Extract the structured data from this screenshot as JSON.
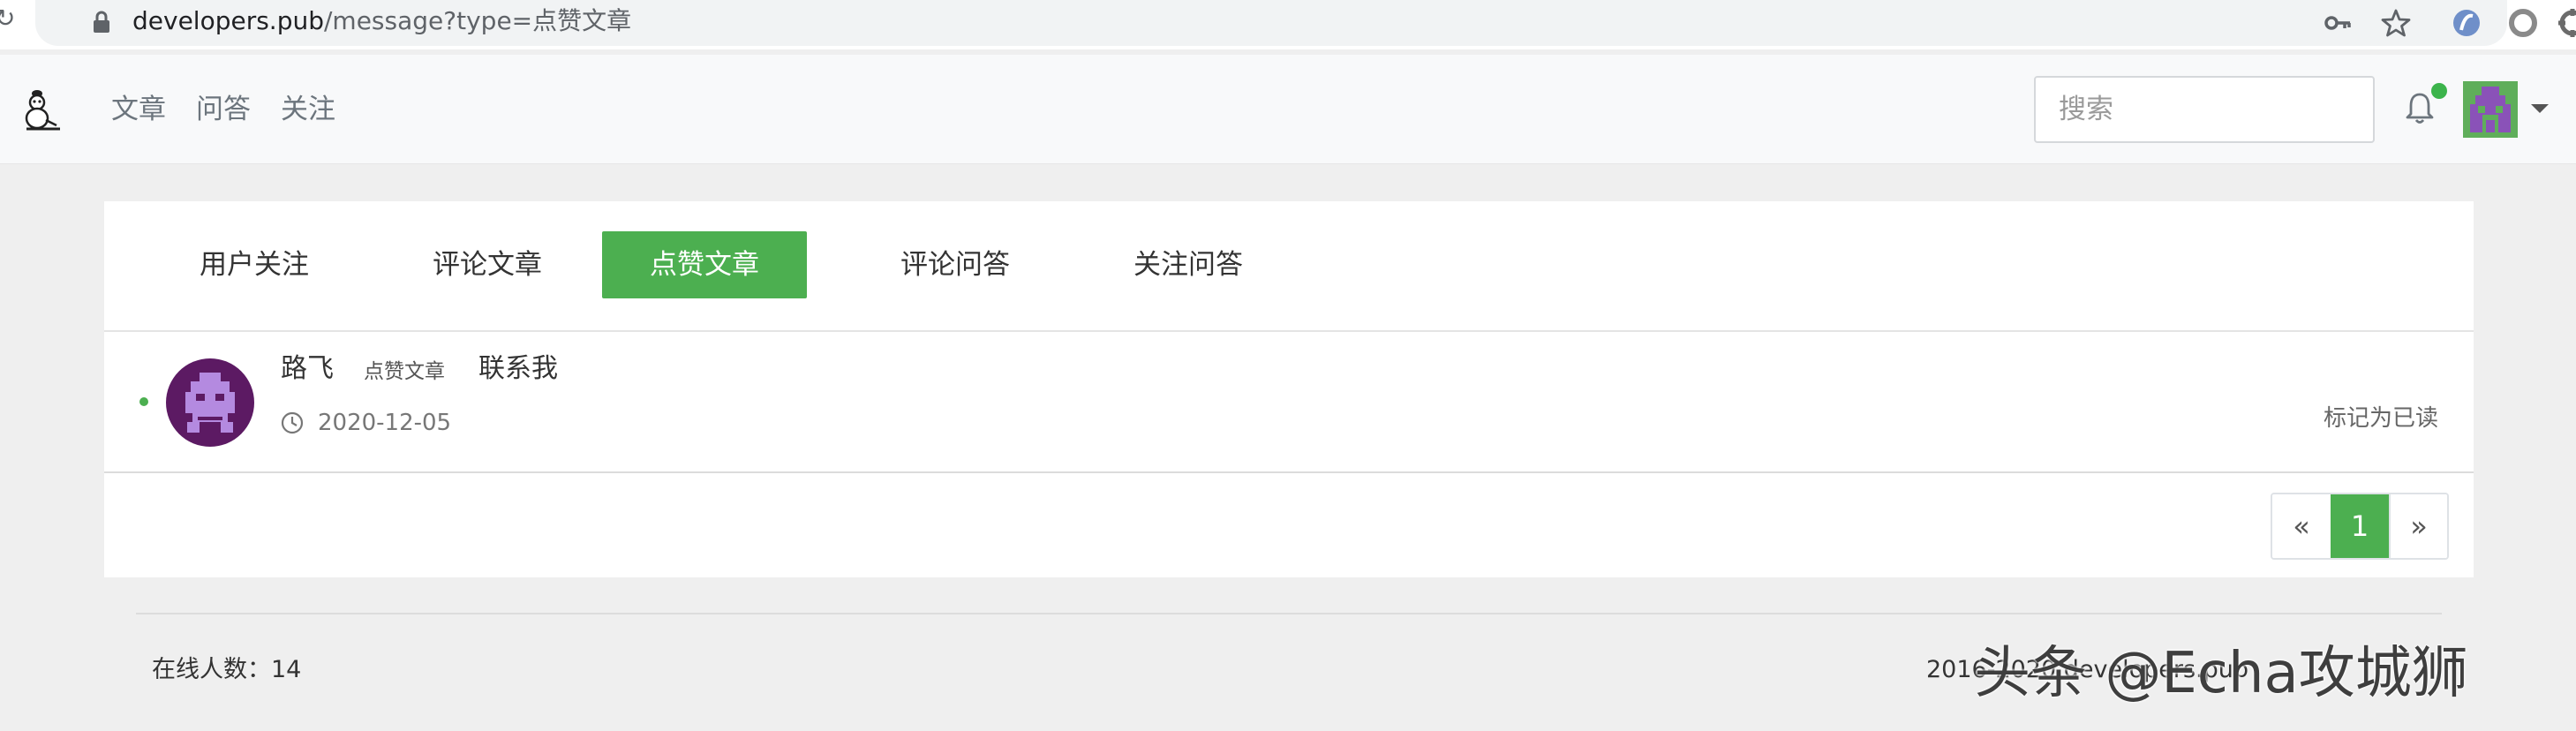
{
  "browser": {
    "url_host": "developers.pub",
    "url_path": "/message?type=点赞文章"
  },
  "header": {
    "nav": [
      "文章",
      "问答",
      "关注"
    ],
    "search_placeholder": "搜索"
  },
  "tabs": [
    "用户关注",
    "评论文章",
    "点赞文章",
    "评论问答",
    "关注问答"
  ],
  "active_tab": "点赞文章",
  "messages": [
    {
      "user": "路飞",
      "type": "点赞文章",
      "title": "联系我",
      "date": "2020-12-05",
      "action": "标记为已读"
    }
  ],
  "pagination": {
    "prev": "«",
    "current": "1",
    "next": "»"
  },
  "footer": {
    "online": "在线人数：14",
    "copyright": "2016-2020 developers.pub"
  },
  "watermark": "头条 @Echa攻城狮",
  "colors": {
    "accent": "#4caf50",
    "background": "#efefef",
    "header": "#f8f9fa"
  },
  "icons": [
    "reload-icon",
    "lock-icon",
    "key-icon",
    "star-icon",
    "bell-icon",
    "clock-icon",
    "caret-down-icon"
  ]
}
